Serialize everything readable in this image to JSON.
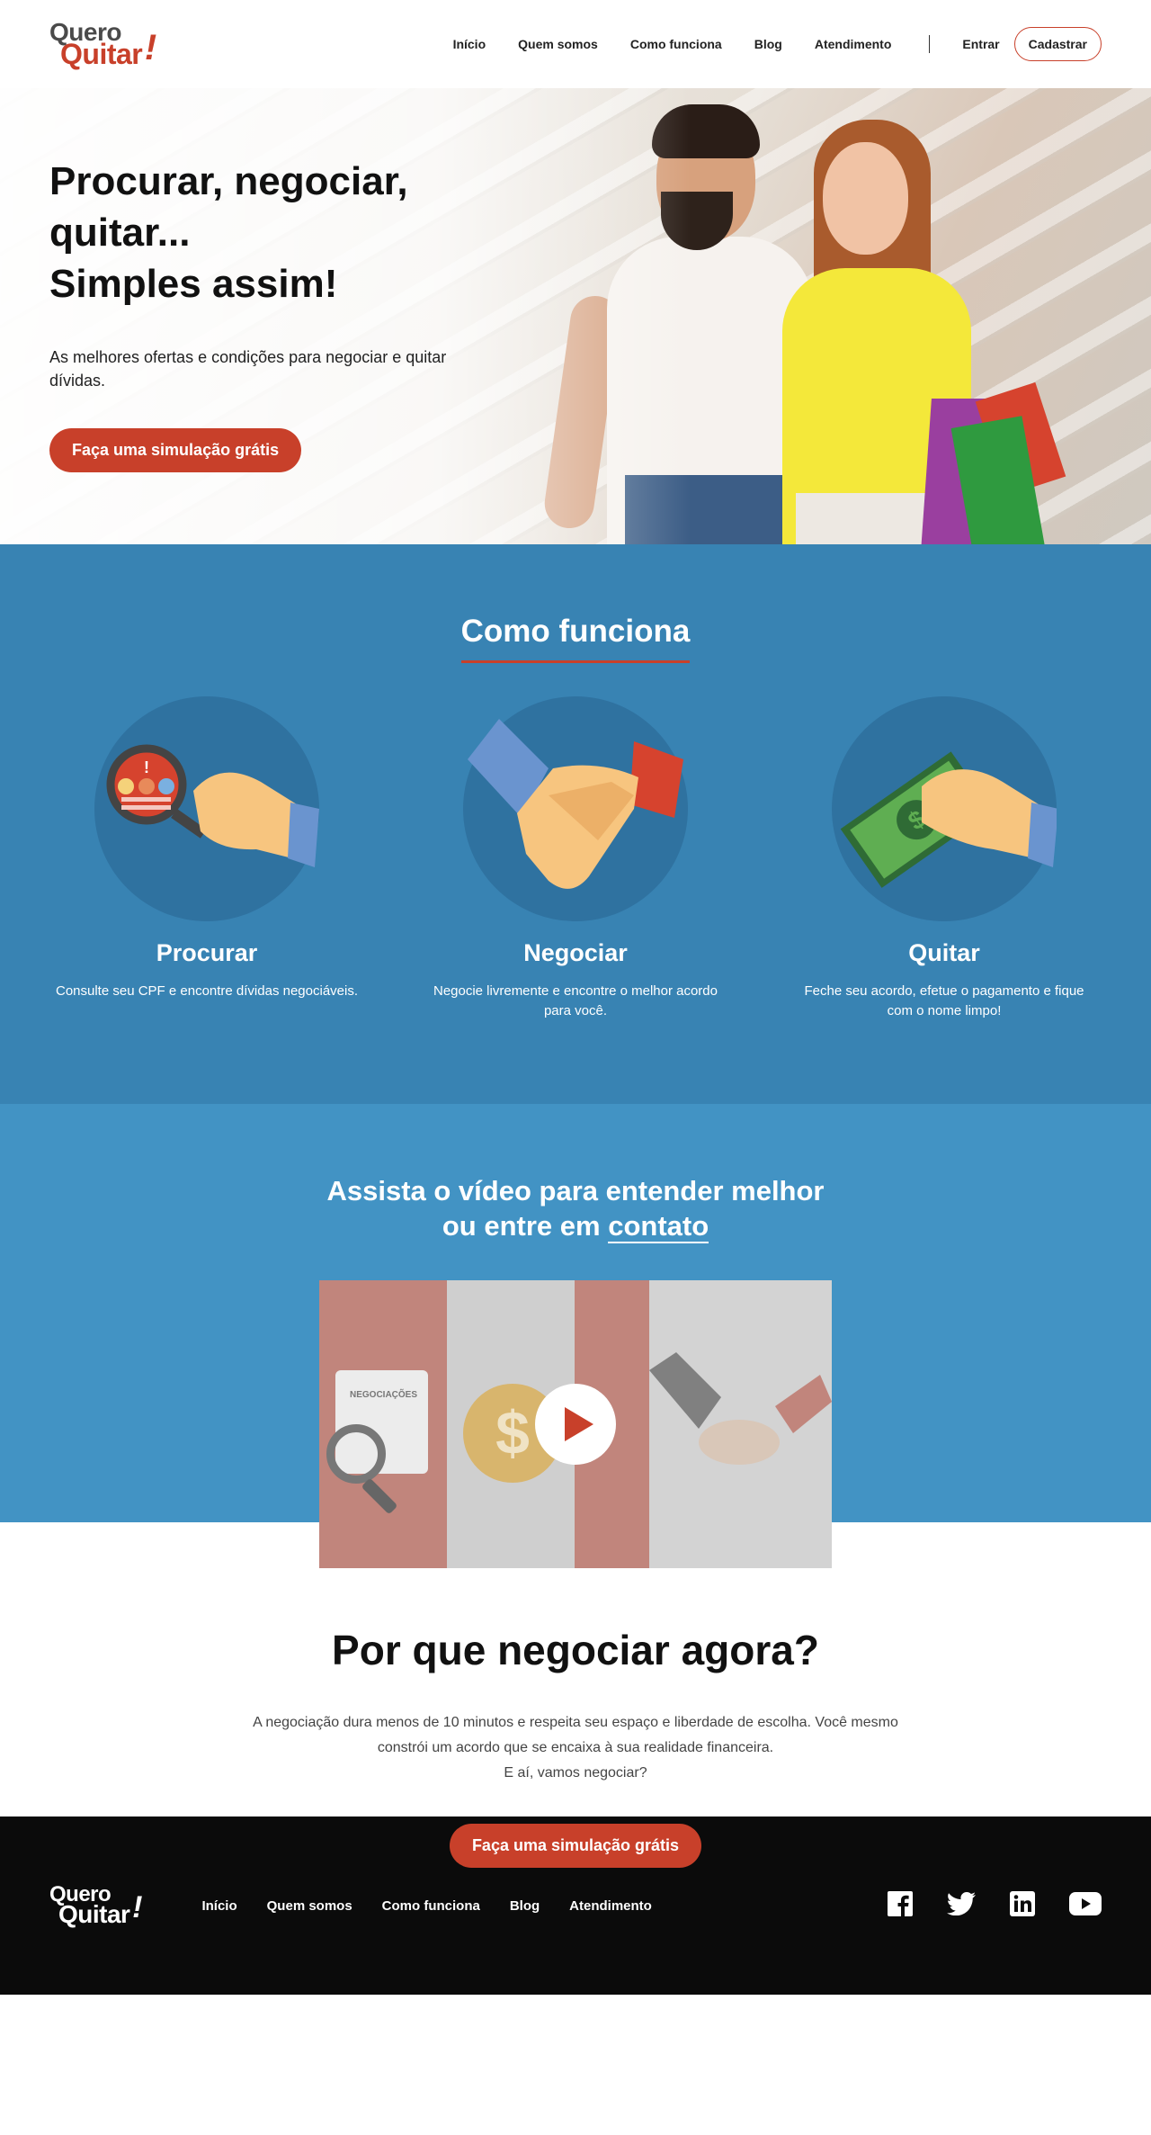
{
  "header": {
    "logo": {
      "line1": "Quero",
      "line2": "Quitar",
      "mark": "!"
    },
    "nav": [
      "Início",
      "Quem somos",
      "Como funciona",
      "Blog",
      "Atendimento"
    ],
    "login": "Entrar",
    "signup": "Cadastrar"
  },
  "hero": {
    "title_line1": "Procurar, negociar,",
    "title_line2": "quitar...",
    "title_line3": "Simples assim!",
    "subtitle": "As melhores ofertas e condições para negociar e quitar dívidas.",
    "cta": "Faça uma simulação grátis"
  },
  "how": {
    "title": "Como funciona",
    "steps": [
      {
        "title": "Procurar",
        "text": "Consulte seu CPF e encontre dívidas negociáveis.",
        "icon": "magnifier-hand-icon"
      },
      {
        "title": "Negociar",
        "text": "Negocie livremente e encontre o melhor acordo para você.",
        "icon": "handshake-icon"
      },
      {
        "title": "Quitar",
        "text": "Feche seu acordo, efetue o pagamento e fique com o nome limpo!",
        "icon": "money-hand-icon"
      }
    ]
  },
  "video": {
    "title_line1": "Assista o vídeo para entender melhor",
    "title_line2_prefix": "ou entre em",
    "title_link": "contato",
    "card_label": "NEGOCIAÇÕES",
    "coin": "$"
  },
  "why": {
    "title": "Por que negociar agora?",
    "text_line1": "A negociação dura menos de 10 minutos e respeita seu espaço e liberdade de escolha. Você mesmo constrói um acordo que se encaixa à sua realidade financeira.",
    "text_line2": "E aí, vamos negociar?",
    "cta": "Faça uma simulação grátis"
  },
  "footer": {
    "logo": {
      "line1": "Quero",
      "line2": "Quitar",
      "mark": "!"
    },
    "nav": [
      "Início",
      "Quem somos",
      "Como funciona",
      "Blog",
      "Atendimento"
    ],
    "social": [
      "facebook-icon",
      "twitter-icon",
      "linkedin-icon",
      "youtube-icon"
    ]
  },
  "colors": {
    "brand_red": "#c8402a",
    "blue_dark": "#3883b3",
    "blue_light": "#4293c4",
    "footer_bg": "#0b0b0b"
  }
}
